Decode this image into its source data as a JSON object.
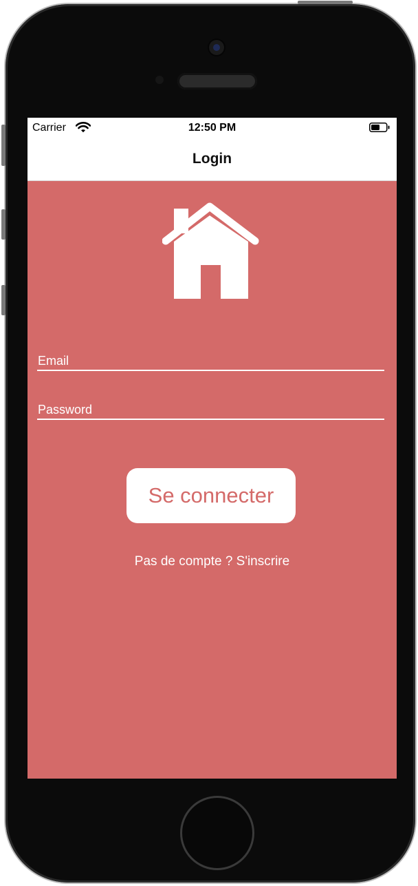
{
  "status_bar": {
    "carrier": "Carrier",
    "time": "12:50 PM",
    "wifi_icon": "wifi-icon",
    "battery_icon": "battery-icon"
  },
  "nav": {
    "title": "Login"
  },
  "logo": {
    "icon": "house-icon",
    "color": "#ffffff"
  },
  "form": {
    "email_placeholder": "Email",
    "password_placeholder": "Password",
    "submit_label": "Se connecter",
    "signup_link": "Pas de compte ? S'inscrire"
  },
  "colors": {
    "background": "#d46a69",
    "button_text": "#d46a69",
    "foreground": "#ffffff"
  }
}
